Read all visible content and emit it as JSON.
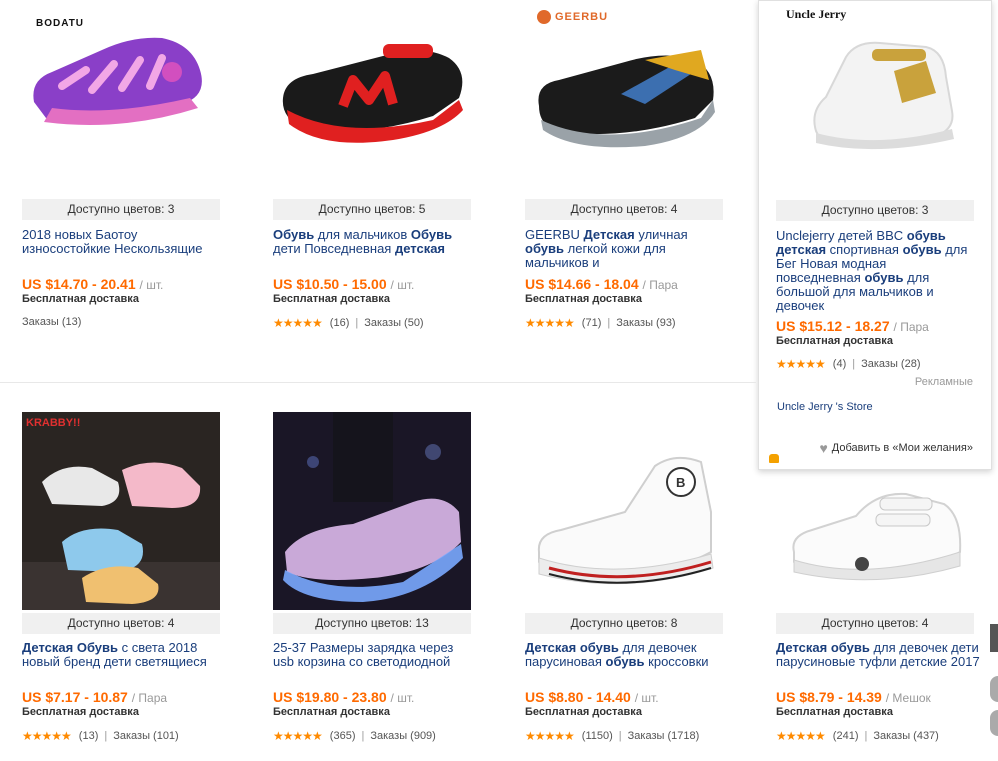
{
  "products": [
    {
      "brand": "BODATU",
      "colors": "Доступно цветов: 3",
      "title_parts": [
        [
          "2018 новых Баотоу износостойкие Нескользящие",
          false
        ]
      ],
      "price": "US $14.70 - 20.41",
      "unit": "/ шт.",
      "shipping": "Бесплатная доставка",
      "rating_count": "",
      "orders": "Заказы (13)",
      "has_stars": false
    },
    {
      "brand": "",
      "colors": "Доступно цветов: 5",
      "title_parts": [
        [
          "Обувь",
          true
        ],
        [
          " для мальчиков ",
          false
        ],
        [
          "Обувь",
          true
        ],
        [
          " дети Повседневная ",
          false
        ],
        [
          "детская",
          true
        ]
      ],
      "price": "US $10.50 - 15.00",
      "unit": "/ шт.",
      "shipping": "Бесплатная доставка",
      "rating_count": "(16)",
      "orders": "Заказы (50)",
      "has_stars": true
    },
    {
      "brand": "GEERBU",
      "colors": "Доступно цветов: 4",
      "title_parts": [
        [
          "GEERBU ",
          false
        ],
        [
          "Детская",
          true
        ],
        [
          " уличная ",
          false
        ],
        [
          "обувь",
          true
        ],
        [
          " легкой кожи для мальчиков и",
          false
        ]
      ],
      "price": "US $14.66 - 18.04",
      "unit": "/ Пара",
      "shipping": "Бесплатная доставка",
      "rating_count": "(71)",
      "orders": "Заказы (93)",
      "has_stars": true
    },
    {
      "brand": "Uncle Jerry",
      "colors": "Доступно цветов: 3",
      "title_parts": [
        [
          "Unclejerry детей BBC ",
          false
        ],
        [
          "обувь детская",
          true
        ],
        [
          " спортивная ",
          false
        ],
        [
          "обувь",
          true
        ],
        [
          " для Бег Новая модная повседневная ",
          false
        ],
        [
          "обувь",
          true
        ],
        [
          " для большой для мальчиков и девочек",
          false
        ]
      ],
      "price": "US $15.12 - 18.27",
      "unit": "/ Пара",
      "shipping": "Бесплатная доставка",
      "rating_count": "(4)",
      "orders": "Заказы (28)",
      "has_stars": true
    },
    {
      "brand": "KRABBY",
      "colors": "Доступно цветов: 4",
      "title_parts": [
        [
          "Детская Обувь",
          true
        ],
        [
          " с света 2018 новый бренд дети светящиеся",
          false
        ]
      ],
      "price": "US $7.17 - 10.87",
      "unit": "/ Пара",
      "shipping": "Бесплатная доставка",
      "rating_count": "(13)",
      "orders": "Заказы (101)",
      "has_stars": true
    },
    {
      "brand": "",
      "colors": "Доступно цветов: 13",
      "title_parts": [
        [
          "25-37 Размеры зарядка через usb корзина со светодиодной",
          false
        ]
      ],
      "price": "US $19.80 - 23.80",
      "unit": "/ шт.",
      "shipping": "Бесплатная доставка",
      "rating_count": "(365)",
      "orders": "Заказы (909)",
      "has_stars": true
    },
    {
      "brand": "",
      "colors": "Доступно цветов: 8",
      "title_parts": [
        [
          "Детская обувь",
          true
        ],
        [
          " для девочек парусиновая ",
          false
        ],
        [
          "обувь",
          true
        ],
        [
          " кроссовки",
          false
        ]
      ],
      "price": "US $8.80 - 14.40",
      "unit": "/ шт.",
      "shipping": "Бесплатная доставка",
      "rating_count": "(1150)",
      "orders": "Заказы (1718)",
      "has_stars": true
    },
    {
      "brand": "",
      "colors": "Доступно цветов: 4",
      "title_parts": [
        [
          "Детская обувь",
          true
        ],
        [
          " для девочек дети парусиновые туфли детские 2017",
          false
        ]
      ],
      "price": "US $8.79 - 14.39",
      "unit": "/ Мешок",
      "shipping": "Бесплатная доставка",
      "rating_count": "(241)",
      "orders": "Заказы (437)",
      "has_stars": true
    }
  ],
  "stars": "★★★★★",
  "popup": {
    "ad_label": "Рекламные",
    "store": "Uncle Jerry 's Store",
    "wishlist": "Добавить в «Мои желания»"
  },
  "colors": {
    "price": "#ff6a00",
    "stars": "#ff8a00",
    "link": "#1a3e7c"
  }
}
